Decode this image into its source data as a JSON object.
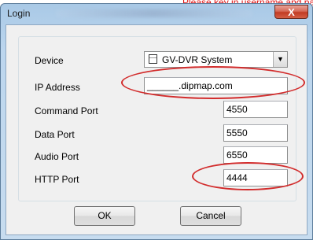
{
  "annotation": {
    "top_text": "Please key in username and password"
  },
  "window": {
    "title": "Login",
    "title_hint": "Please key in username and password",
    "close_glyph": "X"
  },
  "form": {
    "device_label": "Device",
    "device_value": "GV-DVR System",
    "ip_label": "IP Address",
    "ip_value": "______.dipmap.com",
    "command_port_label": "Command Port",
    "command_port_value": "4550",
    "data_port_label": "Data Port",
    "data_port_value": "5550",
    "audio_port_label": "Audio Port",
    "audio_port_value": "6550",
    "http_port_label": "HTTP Port",
    "http_port_value": "4444"
  },
  "buttons": {
    "ok": "OK",
    "cancel": "Cancel"
  },
  "icons": {
    "device_icon": "dvr-device-icon",
    "dropdown": "chevron-down-icon"
  },
  "colors": {
    "annotation": "#d22c2c"
  }
}
